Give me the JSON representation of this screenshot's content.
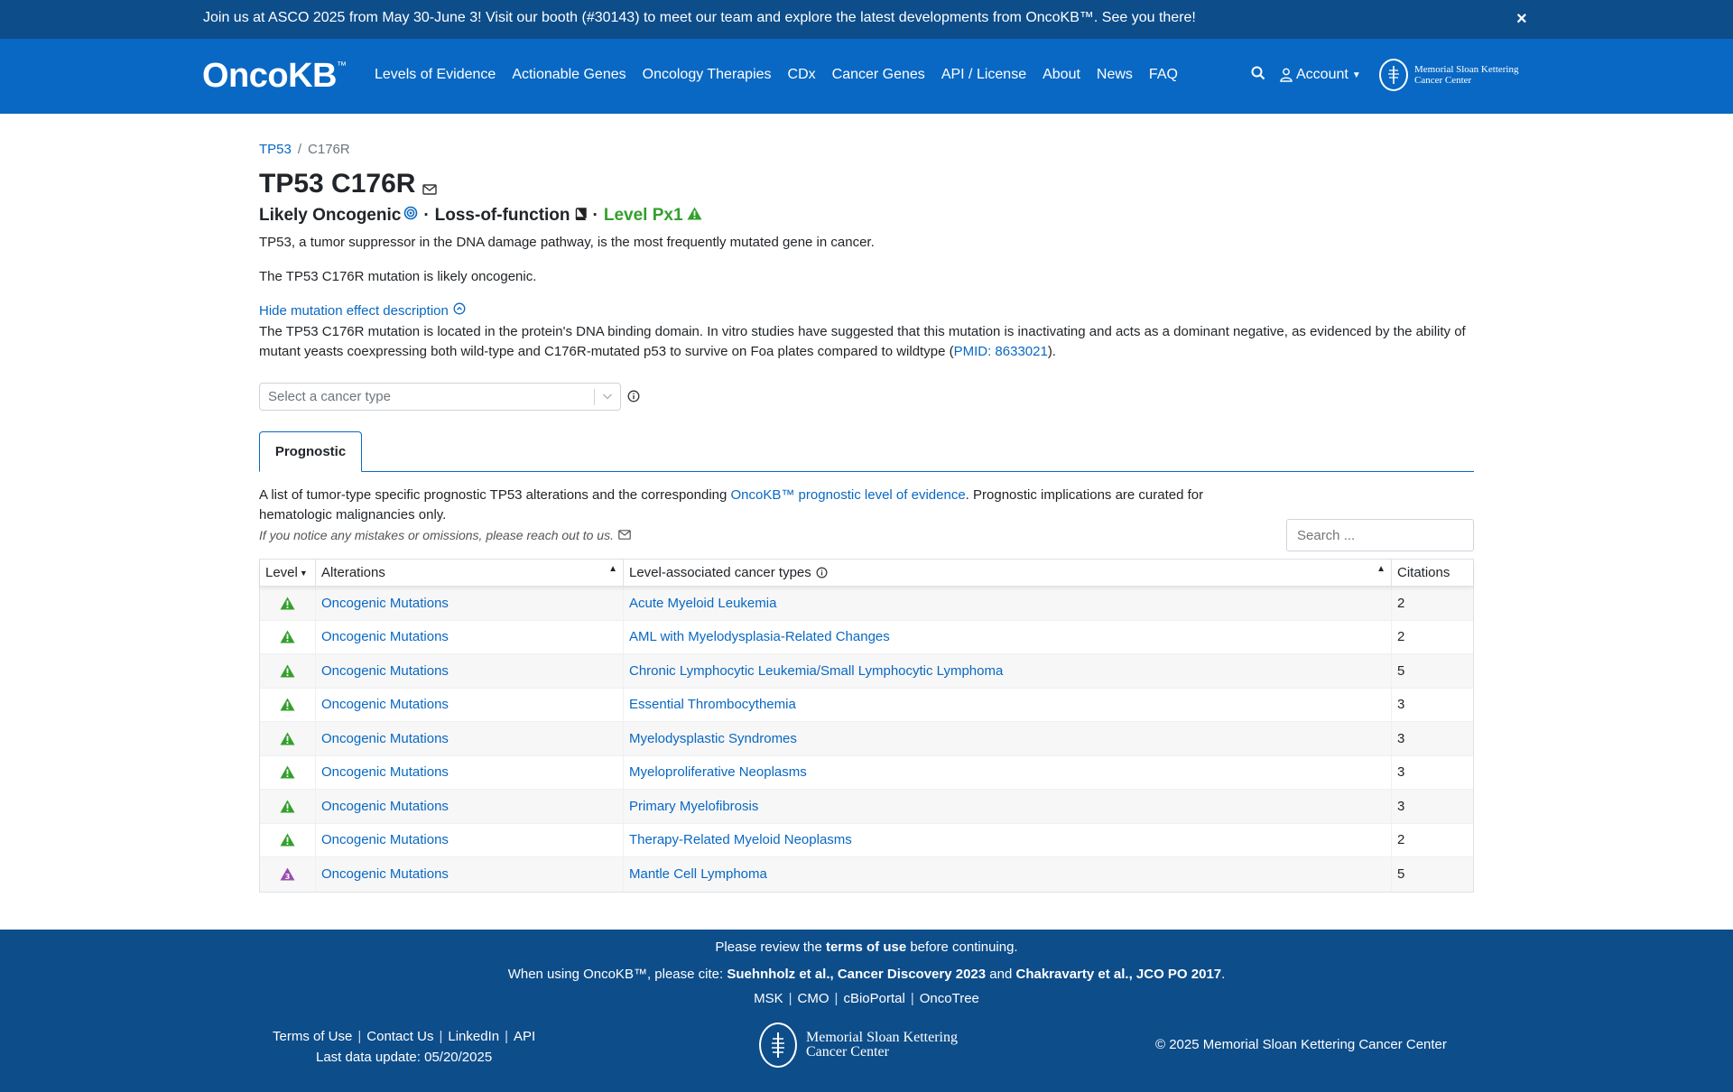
{
  "announcement": {
    "text": "Join us at ASCO 2025 from May 30-June 3! Visit our booth (#30143) to meet our team and explore the latest developments from OncoKB™. See you there!",
    "close": "×"
  },
  "nav": {
    "brand": "OncoKB",
    "brand_tm": "™",
    "links": [
      "Levels of Evidence",
      "Actionable Genes",
      "Oncology Therapies",
      "CDx",
      "Cancer Genes",
      "API / License",
      "About",
      "News",
      "FAQ"
    ],
    "account": "Account",
    "msk_line1": "Memorial Sloan Kettering",
    "msk_line2": "Cancer Center"
  },
  "breadcrumb": {
    "gene": "TP53",
    "sep": "/",
    "alteration": "C176R"
  },
  "title": "TP53 C176R",
  "subtitle": {
    "oncogenicity": "Likely Oncogenic",
    "dot": "·",
    "effect": "Loss-of-function",
    "level": "Level Px1"
  },
  "gene_summary": "TP53, a tumor suppressor in the DNA damage pathway, is the most frequently mutated gene in cancer.",
  "variant_summary": "The TP53 C176R mutation is likely oncogenic.",
  "toggle_label": "Hide mutation effect description",
  "mutation_description": {
    "text": "The TP53 C176R mutation is located in the protein's DNA binding domain. In vitro studies have suggested that this mutation is inactivating and acts as a dominant negative, as evidenced by the ability of mutant yeasts coexpressing both wild-type and C176R-mutated p53 to survive on Foa plates compared to wildtype (",
    "pmid": "PMID: 8633021",
    "end": ")."
  },
  "cancer_type_select": {
    "placeholder": "Select a cancer type"
  },
  "tabs": [
    {
      "label": "Prognostic"
    }
  ],
  "intro": {
    "pre": "A list of tumor-type specific prognostic TP53 alterations and the corresponding ",
    "link": "OncoKB™ prognostic level of evidence",
    "post": ". Prognostic implications are curated for hematologic malignancies only."
  },
  "reach_out": "If you notice any mistakes or omissions, please reach out to us.",
  "search": {
    "placeholder": "Search ..."
  },
  "table": {
    "headers": {
      "level": "Level",
      "alterations": "Alterations",
      "cancer_types": "Level-associated cancer types",
      "citations": "Citations"
    },
    "rows": [
      {
        "level": "Px1",
        "alteration": "Oncogenic Mutations",
        "cancer_type": "Acute Myeloid Leukemia",
        "citations": "2"
      },
      {
        "level": "Px1",
        "alteration": "Oncogenic Mutations",
        "cancer_type": "AML with Myelodysplasia-Related Changes",
        "citations": "2"
      },
      {
        "level": "Px1",
        "alteration": "Oncogenic Mutations",
        "cancer_type": "Chronic Lymphocytic Leukemia/Small Lymphocytic Lymphoma",
        "citations": "5"
      },
      {
        "level": "Px1",
        "alteration": "Oncogenic Mutations",
        "cancer_type": "Essential Thrombocythemia",
        "citations": "3"
      },
      {
        "level": "Px1",
        "alteration": "Oncogenic Mutations",
        "cancer_type": "Myelodysplastic Syndromes",
        "citations": "3"
      },
      {
        "level": "Px1",
        "alteration": "Oncogenic Mutations",
        "cancer_type": "Myeloproliferative Neoplasms",
        "citations": "3"
      },
      {
        "level": "Px1",
        "alteration": "Oncogenic Mutations",
        "cancer_type": "Primary Myelofibrosis",
        "citations": "3"
      },
      {
        "level": "Px1",
        "alteration": "Oncogenic Mutations",
        "cancer_type": "Therapy-Related Myeloid Neoplasms",
        "citations": "2"
      },
      {
        "level": "Px3",
        "alteration": "Oncogenic Mutations",
        "cancer_type": "Mantle Cell Lymphoma",
        "citations": "5"
      }
    ]
  },
  "level_colors": {
    "Px1": "#33a02c",
    "Px3": "#9b4dad"
  },
  "footer": {
    "review_pre": "Please review the ",
    "review_link": "terms of use",
    "review_post": " before continuing.",
    "cite_pre": "When using OncoKB™, please cite: ",
    "cite_1": "Suehnholz et al., Cancer Discovery 2023",
    "cite_and": " and ",
    "cite_2": "Chakravarty et al., JCO PO 2017",
    "cite_end": ".",
    "links": [
      "MSK",
      "CMO",
      "cBioPortal",
      "OncoTree"
    ],
    "left_links": [
      "Terms of Use",
      "Contact Us",
      "LinkedIn",
      "API"
    ],
    "last_update": "Last data update: 05/20/2025",
    "msk_line1": "Memorial Sloan Kettering",
    "msk_line2": "Cancer Center",
    "copyright": "© 2025 Memorial Sloan Kettering Cancer Center"
  }
}
